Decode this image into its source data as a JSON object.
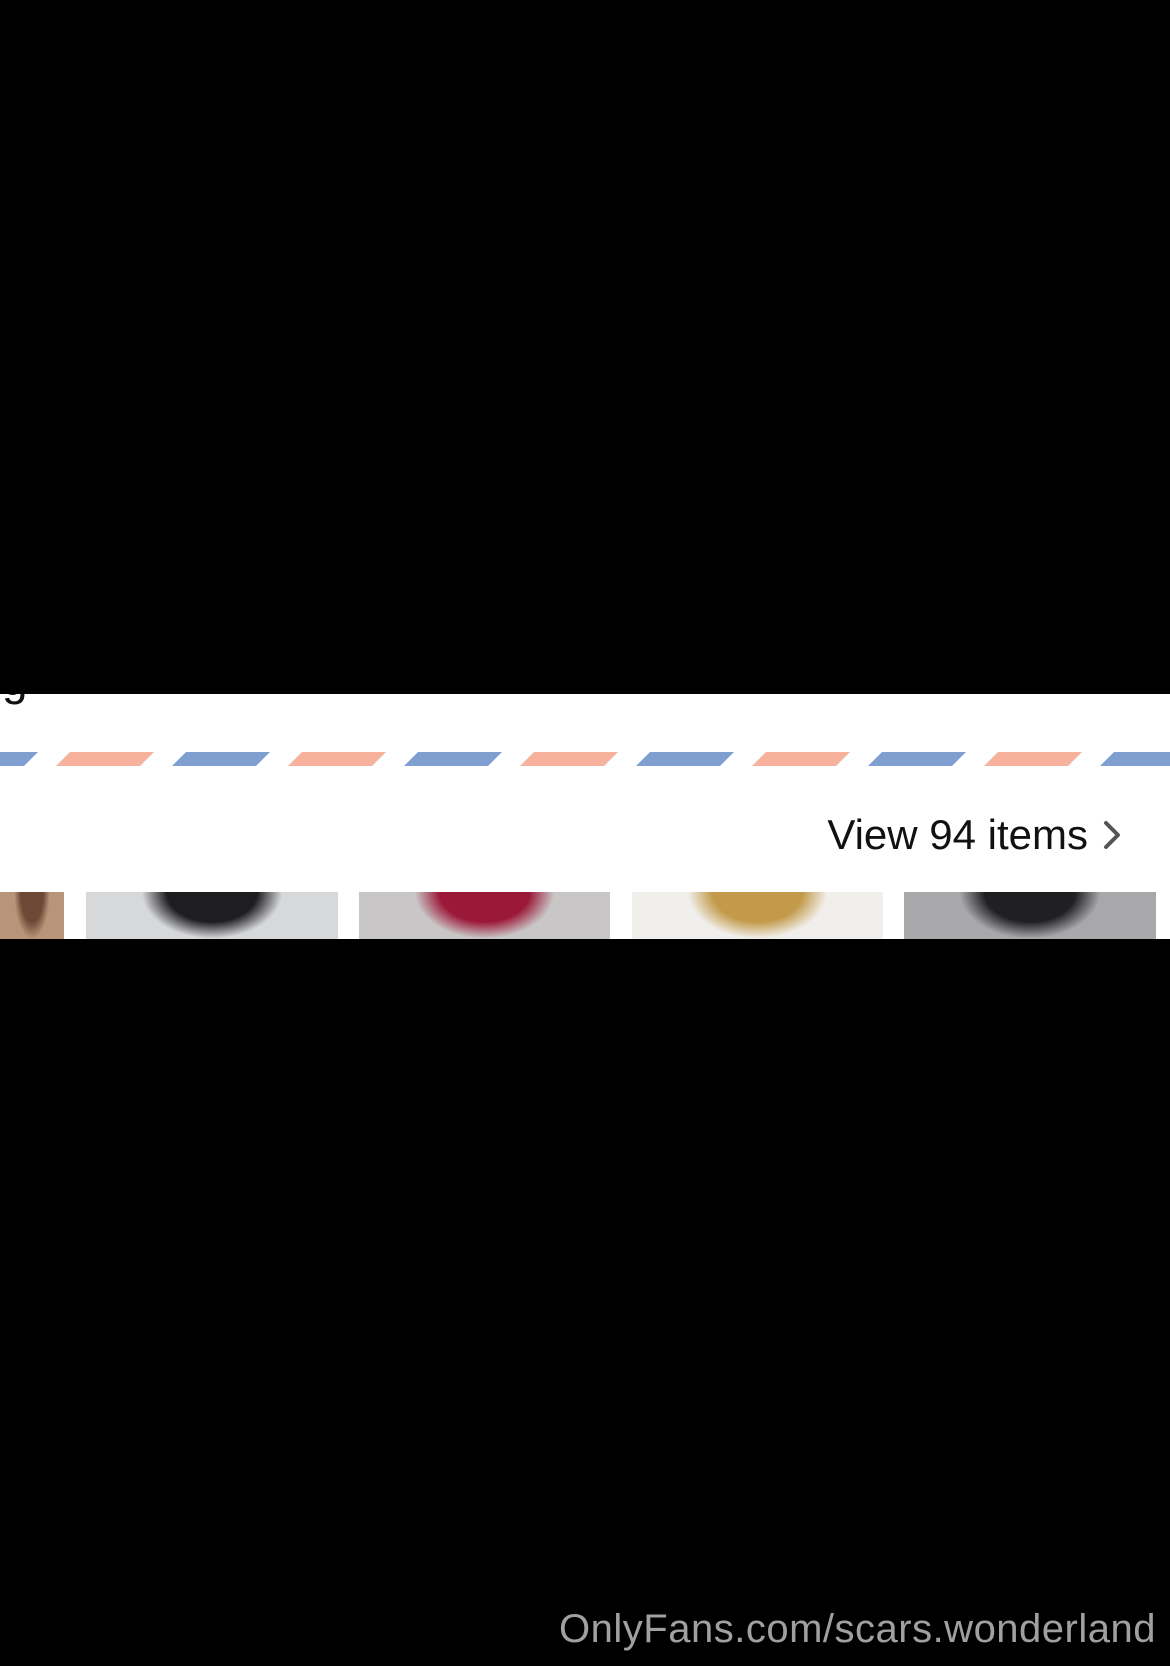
{
  "collection": {
    "view_all_label": "View 94 items",
    "chevron_icon": "chevron-right-icon",
    "stripe_colors": [
      "#7f9fd1",
      "#f6b29c"
    ],
    "thumbnails": [
      {
        "name": "thumbnail-1",
        "bg": "#b89478",
        "accent": "#6c4a36"
      },
      {
        "name": "thumbnail-2",
        "bg": "#d7d8da",
        "accent": "#1e1e20"
      },
      {
        "name": "thumbnail-3",
        "bg": "#c8c6c6",
        "accent": "#9c1838"
      },
      {
        "name": "thumbnail-4",
        "bg": "#f1efec",
        "accent": "#c39a4a"
      },
      {
        "name": "thumbnail-5",
        "bg": "#a8a8aa",
        "accent": "#202022"
      }
    ]
  },
  "watermark": {
    "text": "OnlyFans.com/scars.wonderland"
  }
}
